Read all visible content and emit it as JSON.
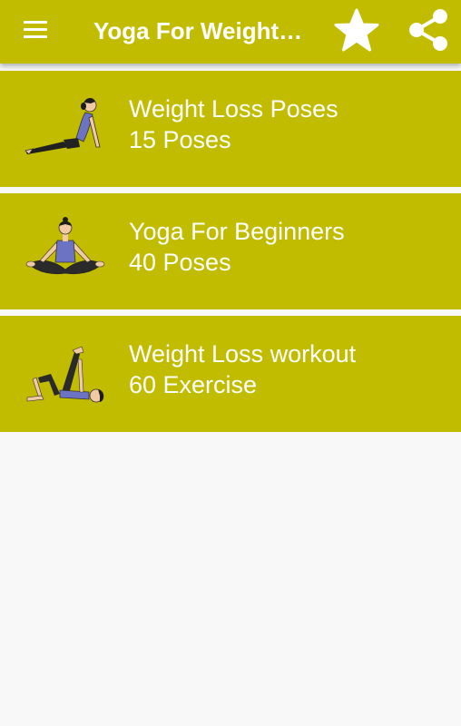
{
  "appbar": {
    "title": "Yoga For Weight…",
    "menu_icon": "hamburger-menu-icon",
    "favorite_icon": "star-icon",
    "share_icon": "share-icon"
  },
  "colors": {
    "primary": "#c2bc00",
    "background": "#f8f8f8",
    "text": "#ffffff"
  },
  "items": [
    {
      "name": "Weight Loss Poses",
      "count": "15 Poses",
      "icon": "cobra-pose-icon"
    },
    {
      "name": "Yoga For Beginners",
      "count": "40 Poses",
      "icon": "lotus-pose-icon"
    },
    {
      "name": "Weight Loss workout",
      "count": "60 Exercise",
      "icon": "leg-raise-pose-icon"
    }
  ]
}
